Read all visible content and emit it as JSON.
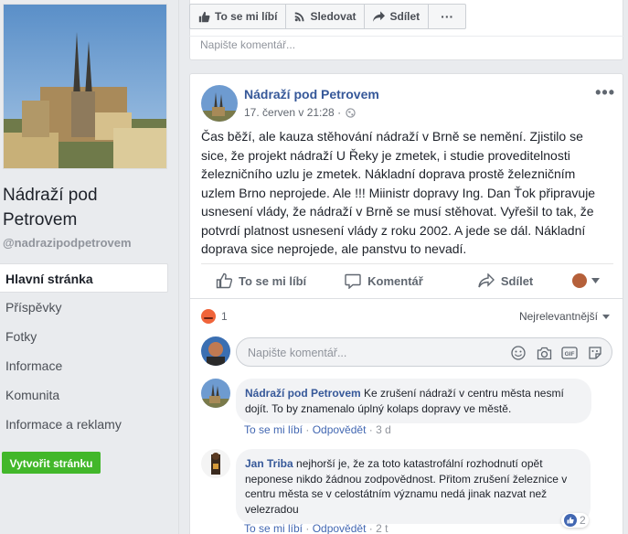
{
  "page": {
    "name": "Nádraží pod Petrovem",
    "handle": "@nadrazipodpetrovem"
  },
  "sidebar": {
    "items": [
      {
        "label": "Hlavní stránka",
        "active": true
      },
      {
        "label": "Příspěvky"
      },
      {
        "label": "Fotky"
      },
      {
        "label": "Informace"
      },
      {
        "label": "Komunita"
      },
      {
        "label": "Informace a reklamy"
      }
    ],
    "create_button": "Vytvořit stránku"
  },
  "top_bar": {
    "like": "To se mi líbí",
    "follow": "Sledovat",
    "share": "Sdílet",
    "more": "···",
    "comment_placeholder": "Napište komentář..."
  },
  "post": {
    "author": "Nádraží pod Petrovem",
    "time": "17. červen v 21:28 ·",
    "text": "Čas běží, ale kauza stěhování nádraží v Brně se nemění. Zjistilo se sice, že projekt nádraží U Řeky je zmetek, i studie proveditelnosti železničního uzlu je zmetek. Nákladní doprava prostě železničním uzlem Brno neprojede. Ale !!! Miinistr dopravy Ing. Dan Ťok připravuje usnesení vlády, že nádraží v Brně se musí stěhovat. Vyřešil to tak, že potvrdí platnost usnesení vlády z roku 2002. A jede se dál. Nákladní doprava sice neprojede, ale panstvu to nevadí.",
    "more": "•••",
    "actions": {
      "like": "To se mi líbí",
      "comment": "Komentář",
      "share": "Sdílet"
    },
    "reaction_count": "1",
    "sort_label": "Nejrelevantnější",
    "comment_placeholder": "Napište komentář..."
  },
  "comments": [
    {
      "author": "Nádraží pod Petrovem",
      "text": "Ke zrušení nádraží v centru města nesmí dojít. To by znamenalo úplný kolaps dopravy ve městě.",
      "like": "To se mi líbí",
      "reply": "Odpovědět",
      "sep": " · ",
      "time": "3 d"
    },
    {
      "author": "Jan Triba",
      "text": "nejhorší je, že za toto katastrofální rozhodnutí opět neponese nikdo žádnou zodpovědnost. Přitom zrušení železnice v centru města se v celostátním významu nedá jinak nazvat než velezradou",
      "like": "To se mi líbí",
      "reply": "Odpovědět",
      "sep": " · ",
      "time": "2 t",
      "likes": "2"
    }
  ],
  "colors": {
    "link": "#365899",
    "green": "#42b72a",
    "bg": "#e9ebee"
  }
}
